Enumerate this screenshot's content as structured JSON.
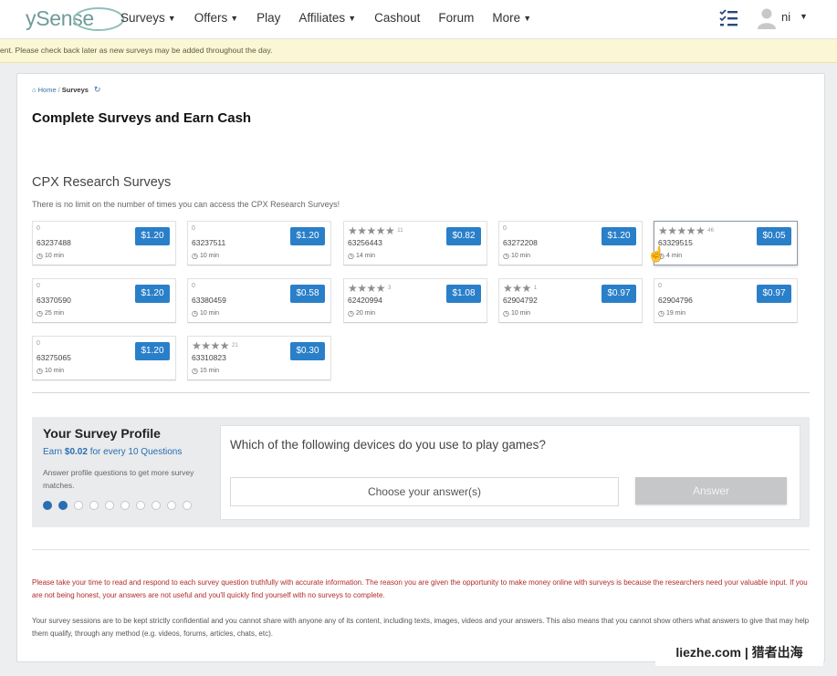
{
  "nav": {
    "logo": "ySense",
    "items": [
      {
        "label": "Surveys",
        "has_dropdown": true
      },
      {
        "label": "Offers",
        "has_dropdown": true
      },
      {
        "label": "Play",
        "has_dropdown": false
      },
      {
        "label": "Affiliates",
        "has_dropdown": true
      },
      {
        "label": "Cashout",
        "has_dropdown": false
      },
      {
        "label": "Forum",
        "has_dropdown": false
      },
      {
        "label": "More",
        "has_dropdown": true
      }
    ],
    "user_name": "ni",
    "icons": {
      "tasks": "checklist-icon",
      "avatar": "user-avatar-icon"
    }
  },
  "notice": "ent. Please check back later as new surveys may be added throughout the day.",
  "breadcrumb": {
    "home": "Home",
    "current": "Surveys"
  },
  "page_title": "Complete Surveys and Earn Cash",
  "section": {
    "title": "CPX Research Surveys",
    "subtitle": "There is no limit on the number of times you can access the CPX Research Surveys!"
  },
  "surveys": [
    {
      "rating": "0",
      "stars": "",
      "reviews": "",
      "id": "63237488",
      "time": "10 min",
      "price": "$1.20"
    },
    {
      "rating": "0",
      "stars": "",
      "reviews": "",
      "id": "63237511",
      "time": "10 min",
      "price": "$1.20"
    },
    {
      "rating": "",
      "stars": "★★★★★",
      "reviews": "11",
      "id": "63256443",
      "time": "14 min",
      "price": "$0.82"
    },
    {
      "rating": "0",
      "stars": "",
      "reviews": "",
      "id": "63272208",
      "time": "10 min",
      "price": "$1.20"
    },
    {
      "rating": "",
      "stars": "★★★★★",
      "reviews": "46",
      "id": "63329515",
      "time": "4 min",
      "price": "$0.05",
      "highlight": true
    },
    {
      "rating": "0",
      "stars": "",
      "reviews": "",
      "id": "63370590",
      "time": "25 min",
      "price": "$1.20"
    },
    {
      "rating": "0",
      "stars": "",
      "reviews": "",
      "id": "63380459",
      "time": "10 min",
      "price": "$0.58"
    },
    {
      "rating": "",
      "stars": "★★★★",
      "reviews": "3",
      "id": "62420994",
      "time": "20 min",
      "price": "$1.08"
    },
    {
      "rating": "",
      "stars": "★★★",
      "reviews": "1",
      "id": "62904792",
      "time": "10 min",
      "price": "$0.97"
    },
    {
      "rating": "0",
      "stars": "",
      "reviews": "",
      "id": "62904796",
      "time": "19 min",
      "price": "$0.97"
    },
    {
      "rating": "0",
      "stars": "",
      "reviews": "",
      "id": "63275065",
      "time": "10 min",
      "price": "$1.20"
    },
    {
      "rating": "",
      "stars": "★★★★",
      "reviews": "21",
      "id": "63310823",
      "time": "15 min",
      "price": "$0.30"
    }
  ],
  "profile": {
    "title": "Your Survey Profile",
    "earn_prefix": "Earn ",
    "earn_amount": "$0.02",
    "earn_suffix": " for every 10 Questions",
    "help": "Answer profile questions to get more survey matches.",
    "dots_total": 10,
    "dots_active": 2,
    "question": "Which of the following devices do you use to play games?",
    "select_placeholder": "Choose your answer(s)",
    "answer_label": "Answer"
  },
  "footer": {
    "warning": "Please take your time to read and respond to each survey question truthfully with accurate information. The reason you are given the opportunity to make money online with surveys is because the researchers need your valuable input. If you are not being honest, your answers are not useful and you'll quickly find yourself with no surveys to complete.",
    "confidential": "Your survey sessions are to be kept strictly confidential and you cannot share with anyone any of its content, including texts, images, videos and your answers. This also means that you cannot show others what answers to give that may help them qualify, through any method (e.g. videos, forums, articles, chats, etc)."
  },
  "watermark": "liezhe.com | 猎者出海"
}
